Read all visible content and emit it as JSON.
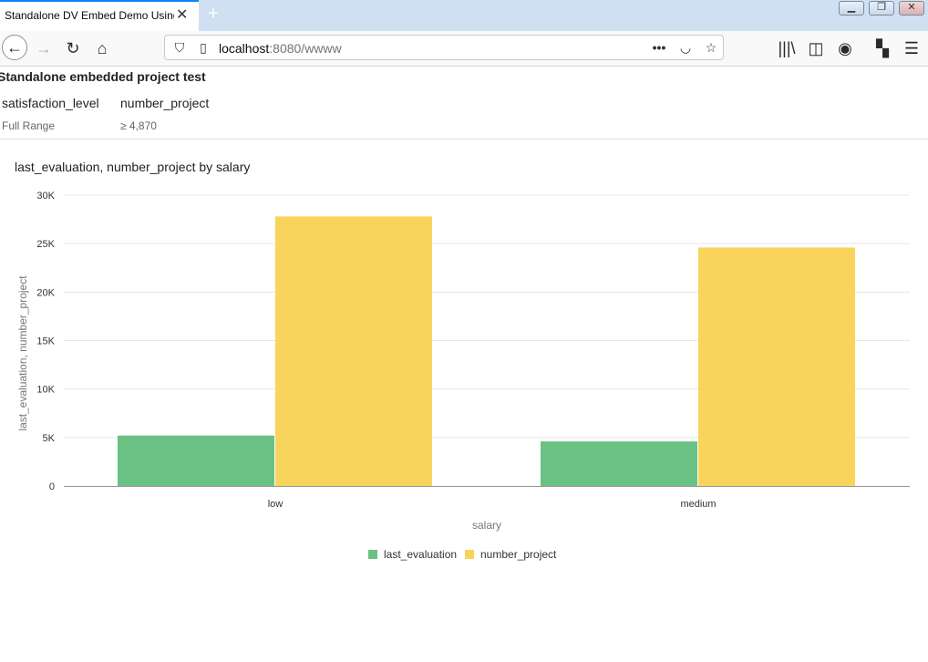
{
  "browser": {
    "tab_title": "Standalone DV Embed Demo Using",
    "tab_close_icon": "close-icon",
    "url_host": "localhost",
    "url_rest": ":8080/wwww"
  },
  "page": {
    "title": "Standalone embedded project test",
    "filters": [
      {
        "label": "satisfaction_level",
        "value": "Full Range"
      },
      {
        "label": "number_project",
        "value": "≥ 4,870"
      }
    ]
  },
  "chart_data": {
    "type": "bar",
    "title": "last_evaluation, number_project by salary",
    "xlabel": "salary",
    "ylabel": "last_evaluation, number_project",
    "categories": [
      "low",
      "medium"
    ],
    "series": [
      {
        "name": "last_evaluation",
        "values": [
          5200,
          4600
        ],
        "color": "#69c283"
      },
      {
        "name": "number_project",
        "values": [
          27800,
          24600
        ],
        "color": "#f8d45c"
      }
    ],
    "ylim": [
      0,
      30000
    ],
    "yticks": [
      {
        "value": 0,
        "label": "0"
      },
      {
        "value": 5000,
        "label": "5K"
      },
      {
        "value": 10000,
        "label": "10K"
      },
      {
        "value": 15000,
        "label": "15K"
      },
      {
        "value": 20000,
        "label": "20K"
      },
      {
        "value": 25000,
        "label": "25K"
      },
      {
        "value": 30000,
        "label": "30K"
      }
    ],
    "grid": true,
    "legend_position": "bottom-center"
  }
}
